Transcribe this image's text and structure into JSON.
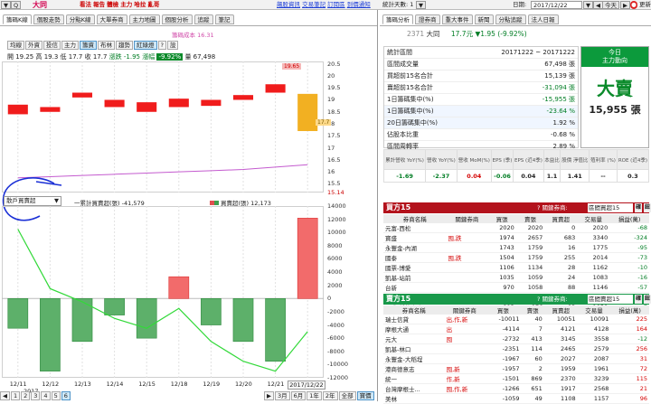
{
  "topbar": {
    "zoom_label": "Q",
    "stock_name": "大同",
    "nav_links": [
      "看法",
      "報告",
      "體檢",
      "主力",
      "哈拉",
      "亂哥"
    ],
    "right_links": [
      "飆股資訊",
      "交易筆記",
      "訂閱區",
      "到價通知"
    ],
    "stats_days_label": "統計天數: 1",
    "date_label": "日期:",
    "date_value": "2017/12/22",
    "today_btn": "今天",
    "update_btn": "更新"
  },
  "left": {
    "tabs": [
      "籌碼K線",
      "個股走勢",
      "分點K線",
      "大單券商",
      "主力地圖",
      "個股分析",
      "追蹤",
      "筆記"
    ],
    "avg_cost_label": "籌碼成本 16.31",
    "period_buttons": [
      "均線",
      "外資",
      "投信",
      "主力",
      "籌資",
      "布林",
      "趨勢",
      "紅綠燈",
      "?",
      "設"
    ],
    "price_line": {
      "open": "開 19.25",
      "high": "高 19.3",
      "low": "低 17.7",
      "close": "收 17.7",
      "change": "漲跌 -1.95",
      "amplitude": "漲幅",
      "pct": "-9.92%",
      "volume": "量 67,498"
    },
    "price_axis": [
      "20.5",
      "20",
      "19.5",
      "19",
      "18.5",
      "18",
      "17.5",
      "17",
      "16.5",
      "16",
      "15.5",
      "15.14"
    ],
    "high_label": "19.65",
    "close_label": "17.7",
    "lower_select": "散戶買賣超",
    "legend_line": "一累計買賣超(張) -41,579",
    "legend_bar": "買賣超(張) 12,173",
    "vol_axis": [
      "14000",
      "12000",
      "10000",
      "8000",
      "6000",
      "4000",
      "2000",
      "0",
      "-2000",
      "-4000",
      "-6000",
      "-8000",
      "-10000",
      "-12000"
    ],
    "x_axis": [
      "12/11",
      "12/12",
      "12/13",
      "12/14",
      "12/15",
      "12/18",
      "12/19",
      "12/20",
      "12/21",
      "2017/12/22"
    ],
    "x_axis_year": "2017",
    "pages": [
      "1",
      "2",
      "3",
      "4",
      "5",
      "6"
    ],
    "range_buttons": [
      "3月",
      "6月",
      "1年",
      "2年",
      "全部",
      "寶價"
    ]
  },
  "right": {
    "tabs": [
      "籌碼分析",
      "證券商",
      "重大事件",
      "新聞",
      "分點追蹤",
      "法人日報"
    ],
    "code": "2371",
    "name": "大同",
    "price": "17.7元",
    "change": "▼1.95 (-9.92%)",
    "stats": [
      {
        "label": "統計區間",
        "value": "20171222 ~ 20171222"
      },
      {
        "label": "區間成交量",
        "value": "67,498 張"
      },
      {
        "label": "買超前15名合計",
        "value": "15,139 張"
      },
      {
        "label": "賣超前15名合計",
        "value": "-31,094 張"
      },
      {
        "label": "1日籌碼集中(%)",
        "value": "-15,955 張"
      },
      {
        "label": "1日籌碼集中(%)",
        "value": "-23.64 %"
      },
      {
        "label": "20日籌碼集中(%)",
        "value": "1.92 %"
      },
      {
        "label": "佔股本比重",
        "value": "-0.68 %"
      },
      {
        "label": "區間周轉率",
        "value": "2.89 %"
      }
    ],
    "today": {
      "title": "今日",
      "subtitle": "主力動向",
      "verdict": "大賣",
      "amount": "15,955 張"
    },
    "fin_headers": [
      "累計營收 YoY(%)",
      "營收 YoY(%)",
      "營收 MoM(%)",
      "EPS (季)",
      "EPS (近4季)",
      "本益比",
      "股價 淨值比",
      "殖利率 (%)",
      "ROE (近4季)"
    ],
    "fin_values": [
      "-1.69",
      "-2.37",
      "0.04",
      "-0.06",
      "0.04",
      "1.1",
      "1.41",
      "--",
      "0.3"
    ],
    "buy_title": "買方15",
    "buy_query_label": "? 關鍵券商:",
    "buy_select": "區間買超15",
    "table_headers": [
      "券商名稱",
      "關鍵券商",
      "買張",
      "賣張",
      "買賣超",
      "交易量",
      "損益(萬)"
    ],
    "buy_rows": [
      [
        "元富-西松",
        "",
        "2020",
        "2020",
        "0",
        "2020",
        "-68"
      ],
      [
        "寶盛",
        "囤,跌",
        "1974",
        "2657",
        "683",
        "3340",
        "-324"
      ],
      [
        "永豐金-內湖",
        "",
        "1743",
        "1759",
        "16",
        "1775",
        "-95"
      ],
      [
        "國泰",
        "囤,跌",
        "1504",
        "1759",
        "255",
        "2014",
        "-73"
      ],
      [
        "國票-博愛",
        "",
        "1106",
        "1134",
        "28",
        "1162",
        "-10"
      ],
      [
        "凱基-站前",
        "",
        "1035",
        "1059",
        "24",
        "1083",
        "-16"
      ],
      [
        "台新",
        "",
        "970",
        "1058",
        "88",
        "1146",
        "-57"
      ],
      [
        "華南永昌-古亭",
        "",
        "912",
        "912",
        "0",
        "912",
        "-5"
      ],
      [
        "日盛-新竹中山",
        "",
        "893",
        "976",
        "83",
        "1059",
        "-7"
      ]
    ],
    "sell_title": "賣方15",
    "sell_query_label": "? 關鍵券商:",
    "sell_select": "區間賣超15",
    "sell_rows": [
      [
        "瑞士信貸",
        "出,作,新",
        "-10011",
        "40",
        "10051",
        "10091",
        "225"
      ],
      [
        "摩根大通",
        "出",
        "-4114",
        "7",
        "4121",
        "4128",
        "164"
      ],
      [
        "元大",
        "囤",
        "-2732",
        "413",
        "3145",
        "3558",
        "-12"
      ],
      [
        "凱基-林口",
        "",
        "-2351",
        "114",
        "2465",
        "2579",
        "256"
      ],
      [
        "永豐金-大稻埕",
        "",
        "-1967",
        "60",
        "2027",
        "2087",
        "31"
      ],
      [
        "港商德意志",
        "囤,新",
        "-1957",
        "2",
        "1959",
        "1961",
        "72"
      ],
      [
        "統一",
        "作,新",
        "-1501",
        "869",
        "2370",
        "3239",
        "115"
      ],
      [
        "台灣摩根士...",
        "囤,作,新",
        "-1266",
        "651",
        "1917",
        "2568",
        "21"
      ],
      [
        "美林",
        "",
        "-1059",
        "49",
        "1108",
        "1157",
        "96"
      ]
    ],
    "btn_go": "確",
    "btn_up": "鈕"
  },
  "chart_data": [
    {
      "type": "candlestick",
      "title": "",
      "x": [
        "12/11",
        "12/12",
        "12/13",
        "12/14",
        "12/15",
        "12/18",
        "12/19",
        "12/20",
        "12/21",
        "12/22"
      ],
      "open": [
        18.8,
        18.7,
        19.1,
        19.0,
        18.9,
        19.05,
        19.0,
        19.2,
        19.3,
        19.25
      ],
      "close": [
        18.4,
        18.5,
        19.3,
        18.7,
        18.5,
        18.7,
        18.75,
        19.0,
        19.65,
        17.7
      ],
      "high": [
        18.8,
        18.7,
        19.3,
        19.0,
        18.9,
        19.05,
        19.0,
        19.2,
        19.65,
        19.3
      ],
      "low": [
        18.4,
        18.5,
        19.1,
        18.7,
        18.5,
        18.7,
        18.75,
        19.0,
        19.3,
        17.7
      ],
      "ma": [
        15.75,
        15.8,
        15.85,
        15.9,
        15.95,
        16.0,
        16.05,
        16.1,
        16.2,
        16.3
      ],
      "ylim": [
        15.14,
        20.6
      ]
    },
    {
      "type": "bar",
      "title": "",
      "categories": [
        "12/11",
        "12/12",
        "12/13",
        "12/14",
        "12/15",
        "12/18",
        "12/19",
        "12/20",
        "12/21",
        "12/22"
      ],
      "series": [
        {
          "name": "買賣超(張)",
          "values": [
            -4500,
            -11000,
            -6500,
            -2500,
            -6000,
            3300,
            -4000,
            -6500,
            -9500,
            12173
          ]
        },
        {
          "name": "累計買賣超(張)",
          "values": [
            10500,
            1500,
            -500,
            -3000,
            -4500,
            -1500,
            -6500,
            -9500,
            -11000,
            -5000
          ]
        }
      ],
      "ylim": [
        -12000,
        14000
      ]
    }
  ]
}
